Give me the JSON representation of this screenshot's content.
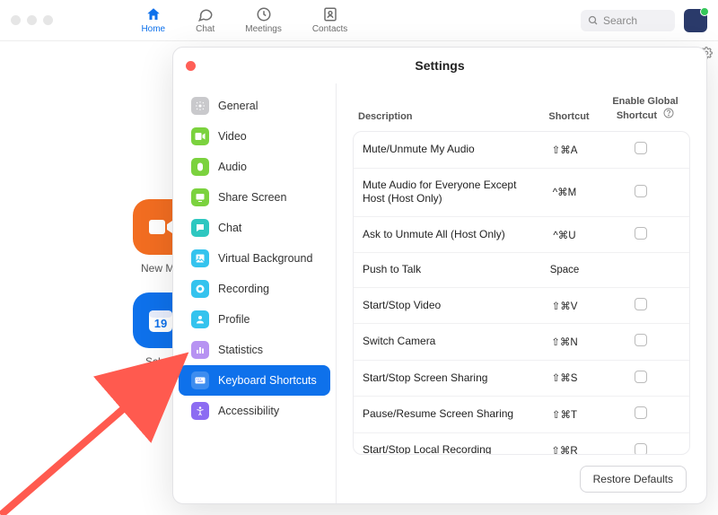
{
  "nav": {
    "tabs": [
      {
        "id": "home",
        "label": "Home",
        "active": true
      },
      {
        "id": "chat",
        "label": "Chat",
        "active": false
      },
      {
        "id": "meetings",
        "label": "Meetings",
        "active": false
      },
      {
        "id": "contacts",
        "label": "Contacts",
        "active": false
      }
    ],
    "search_placeholder": "Search"
  },
  "bg": {
    "new_meeting_label": "New Me",
    "schedule_label": "Sched",
    "calendar_day": "19"
  },
  "modal": {
    "title": "Settings",
    "sidebar": [
      {
        "id": "general",
        "label": "General",
        "color": "#c9c9cc"
      },
      {
        "id": "video",
        "label": "Video",
        "color": "#7bd23e"
      },
      {
        "id": "audio",
        "label": "Audio",
        "color": "#7bd23e"
      },
      {
        "id": "share",
        "label": "Share Screen",
        "color": "#7bd23e"
      },
      {
        "id": "chat",
        "label": "Chat",
        "color": "#2ec7c0"
      },
      {
        "id": "vbg",
        "label": "Virtual Background",
        "color": "#34c3ee"
      },
      {
        "id": "rec",
        "label": "Recording",
        "color": "#34c3ee"
      },
      {
        "id": "profile",
        "label": "Profile",
        "color": "#34c3ee"
      },
      {
        "id": "stats",
        "label": "Statistics",
        "color": "#b793f2"
      },
      {
        "id": "kb",
        "label": "Keyboard Shortcuts",
        "color": "#6d8cff",
        "active": true
      },
      {
        "id": "a11y",
        "label": "Accessibility",
        "color": "#8c6cf2"
      }
    ],
    "columns": {
      "description": "Description",
      "shortcut": "Shortcut",
      "enable": "Enable Global Shortcut"
    },
    "rows": [
      {
        "desc": "Mute/Unmute My Audio",
        "shortcut": "⇧⌘A",
        "checkbox": true
      },
      {
        "desc": "Mute Audio for Everyone Except Host (Host Only)",
        "shortcut": "^⌘M",
        "checkbox": true
      },
      {
        "desc": "Ask to Unmute All (Host Only)",
        "shortcut": "^⌘U",
        "checkbox": true
      },
      {
        "desc": "Push to Talk",
        "shortcut": "Space",
        "checkbox": false
      },
      {
        "desc": "Start/Stop Video",
        "shortcut": "⇧⌘V",
        "checkbox": true
      },
      {
        "desc": "Switch Camera",
        "shortcut": "⇧⌘N",
        "checkbox": true
      },
      {
        "desc": "Start/Stop Screen Sharing",
        "shortcut": "⇧⌘S",
        "checkbox": true
      },
      {
        "desc": "Pause/Resume Screen Sharing",
        "shortcut": "⇧⌘T",
        "checkbox": true
      },
      {
        "desc": "Start/Stop Local Recording",
        "shortcut": "⇧⌘R",
        "checkbox": true
      }
    ],
    "restore_label": "Restore Defaults"
  }
}
